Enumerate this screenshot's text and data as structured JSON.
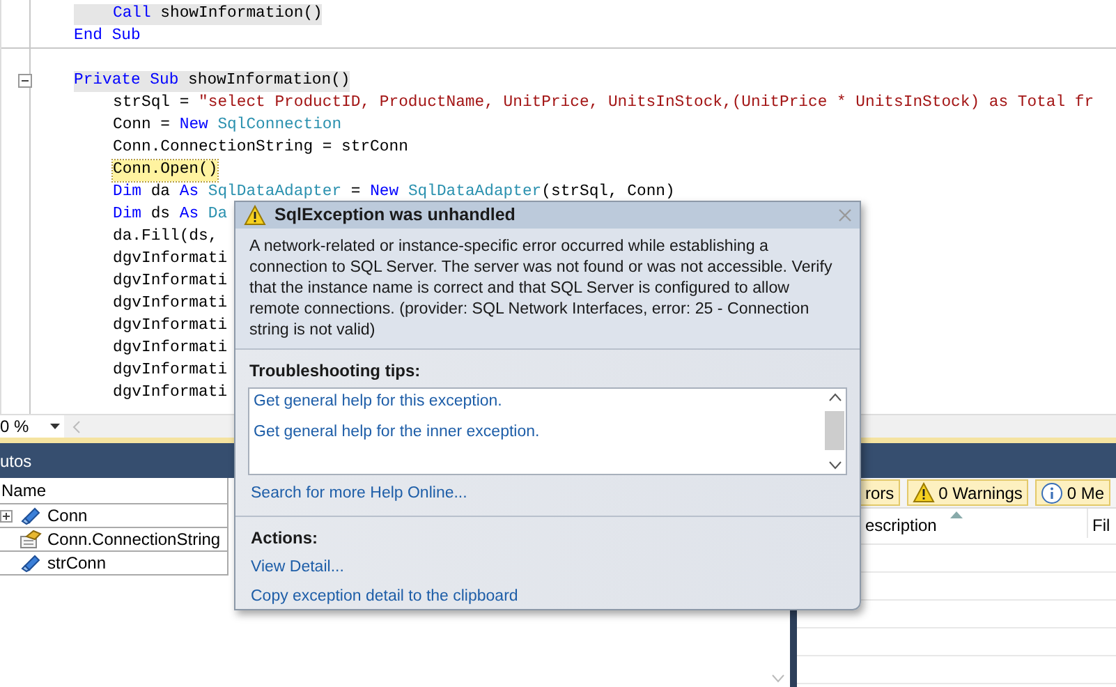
{
  "editor": {
    "lines": [
      {
        "kind": "body",
        "highlighted": true,
        "current": false,
        "tokens": [
          {
            "kind": "keyword",
            "text": "Call"
          },
          {
            "kind": "plain",
            "text": " showInformation()"
          }
        ]
      },
      {
        "kind": "block",
        "highlighted": false,
        "current": false,
        "tokens": [
          {
            "kind": "keyword",
            "text": "End Sub"
          }
        ]
      },
      {
        "kind": "separator"
      },
      {
        "kind": "block",
        "highlighted": true,
        "current": false,
        "collapsible": true,
        "tokens": [
          {
            "kind": "keyword",
            "text": "Private Sub"
          },
          {
            "kind": "plain",
            "text": " showInformation()"
          }
        ]
      },
      {
        "kind": "body",
        "highlighted": false,
        "current": false,
        "tokens": [
          {
            "kind": "plain",
            "text": "strSql = "
          },
          {
            "kind": "string",
            "text": "\"select ProductID, ProductName, UnitPrice, UnitsInStock,(UnitPrice * UnitsInStock) as Total fr"
          }
        ]
      },
      {
        "kind": "body",
        "highlighted": false,
        "current": false,
        "tokens": [
          {
            "kind": "plain",
            "text": "Conn = "
          },
          {
            "kind": "keyword",
            "text": "New"
          },
          {
            "kind": "type",
            "text": " SqlConnection"
          }
        ]
      },
      {
        "kind": "body",
        "highlighted": false,
        "current": false,
        "tokens": [
          {
            "kind": "plain",
            "text": "Conn.ConnectionString = strConn"
          }
        ]
      },
      {
        "kind": "body",
        "highlighted": false,
        "current": true,
        "tokens": [
          {
            "kind": "plain",
            "text": "Conn.Open()"
          }
        ]
      },
      {
        "kind": "body",
        "highlighted": false,
        "current": false,
        "tokens": [
          {
            "kind": "keyword",
            "text": "Dim"
          },
          {
            "kind": "plain",
            "text": " da "
          },
          {
            "kind": "keyword",
            "text": "As"
          },
          {
            "kind": "type",
            "text": " SqlDataAdapter"
          },
          {
            "kind": "plain",
            "text": " = "
          },
          {
            "kind": "keyword",
            "text": "New"
          },
          {
            "kind": "type",
            "text": " SqlDataAdapter"
          },
          {
            "kind": "plain",
            "text": "(strSql, Conn)"
          }
        ]
      },
      {
        "kind": "body",
        "highlighted": false,
        "current": false,
        "tokens": [
          {
            "kind": "keyword",
            "text": "Dim"
          },
          {
            "kind": "plain",
            "text": " ds "
          },
          {
            "kind": "keyword",
            "text": "As"
          },
          {
            "kind": "type",
            "text": " Da"
          }
        ]
      },
      {
        "kind": "body",
        "highlighted": false,
        "current": false,
        "tokens": [
          {
            "kind": "plain",
            "text": "da.Fill(ds,"
          }
        ]
      },
      {
        "kind": "body",
        "highlighted": false,
        "current": false,
        "tokens": [
          {
            "kind": "plain",
            "text": "dgvInformati"
          }
        ]
      },
      {
        "kind": "body",
        "highlighted": false,
        "current": false,
        "tokens": [
          {
            "kind": "plain",
            "text": "dgvInformati"
          }
        ]
      },
      {
        "kind": "body",
        "highlighted": false,
        "current": false,
        "tokens": [
          {
            "kind": "plain",
            "text": "dgvInformati"
          }
        ]
      },
      {
        "kind": "body",
        "highlighted": false,
        "current": false,
        "tokens": [
          {
            "kind": "plain",
            "text": "dgvInformati"
          }
        ]
      },
      {
        "kind": "body",
        "highlighted": false,
        "current": false,
        "tokens": [
          {
            "kind": "plain",
            "text": "dgvInformati"
          }
        ]
      },
      {
        "kind": "body",
        "highlighted": false,
        "current": false,
        "tokens": [
          {
            "kind": "plain",
            "text": "dgvInformati"
          }
        ]
      },
      {
        "kind": "body",
        "highlighted": false,
        "current": false,
        "tokens": [
          {
            "kind": "plain",
            "text": "dgvInformati"
          }
        ]
      }
    ]
  },
  "zoom": {
    "value": "0 %"
  },
  "autos": {
    "title": "utos",
    "columns": [
      "Name"
    ],
    "rows": [
      {
        "name": "Conn",
        "kind": "variable",
        "expandable": true
      },
      {
        "name": "Conn.ConnectionString",
        "kind": "property",
        "expandable": false
      },
      {
        "name": "strConn",
        "kind": "variable",
        "expandable": false
      }
    ]
  },
  "error_list": {
    "filters": [
      {
        "kind": "errors",
        "label": "rors"
      },
      {
        "kind": "warnings",
        "label": "0 Warnings"
      },
      {
        "kind": "messages",
        "label": "0 Me"
      }
    ],
    "columns": [
      {
        "label": "escription",
        "sorted": true
      },
      {
        "label": "Fil",
        "sorted": false
      }
    ]
  },
  "dialog": {
    "title": "SqlException was unhandled",
    "message": "A network-related or instance-specific error occurred while establishing a connection to SQL Server. The server was not found or was not accessible. Verify that the instance name is correct and that SQL Server is configured to allow remote connections. (provider: SQL Network Interfaces, error: 25 - Connection string is not valid)",
    "tips_heading": "Troubleshooting tips:",
    "tips": [
      "Get general help for this exception.",
      "Get general help for the inner exception."
    ],
    "search_link": "Search for more Help Online...",
    "actions_heading": "Actions:",
    "actions": [
      "View Detail...",
      "Copy exception detail to the clipboard"
    ]
  }
}
